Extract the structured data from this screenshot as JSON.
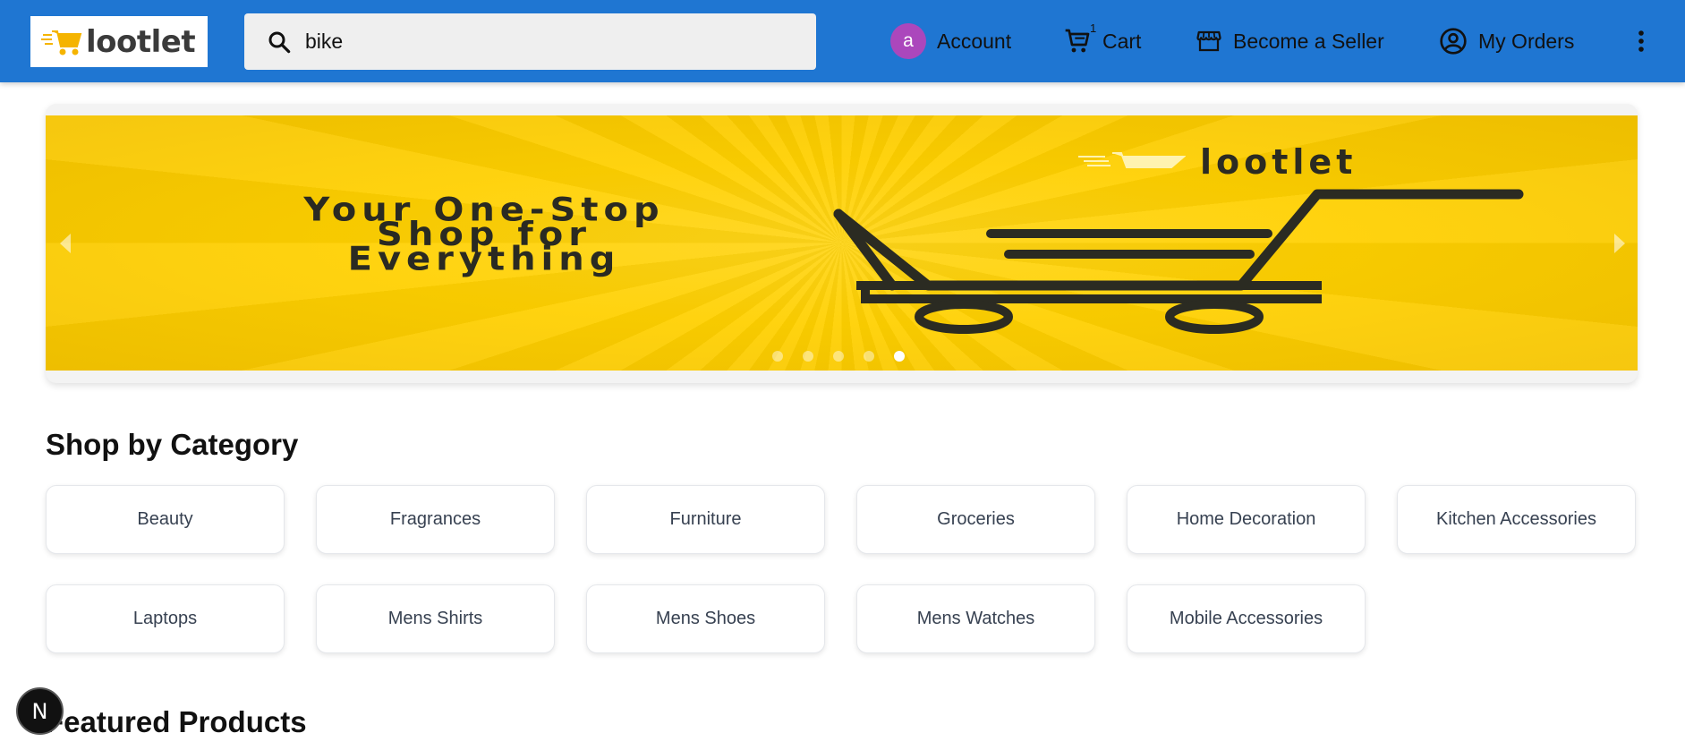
{
  "header": {
    "logo_text": "lootlet",
    "search": {
      "value": "bike"
    },
    "account": {
      "avatar_letter": "a",
      "label": "Account"
    },
    "cart": {
      "label": "Cart",
      "count": "1"
    },
    "seller": {
      "label": "Become a Seller"
    },
    "orders": {
      "label": "My Orders"
    }
  },
  "banner": {
    "slogan": "Your One-Stop Shop for Everything",
    "brand": "lootlet",
    "slides": 5,
    "active_slide": 5,
    "colors": {
      "background": "#ffd000",
      "ink": "#2b2b22"
    }
  },
  "categories": {
    "title": "Shop by Category",
    "items": [
      "Beauty",
      "Fragrances",
      "Furniture",
      "Groceries",
      "Home Decoration",
      "Kitchen Accessories",
      "Laptops",
      "Mens Shirts",
      "Mens Shoes",
      "Mens Watches",
      "Mobile Accessories"
    ]
  },
  "featured": {
    "title": "Featured Products"
  },
  "dev_badge": {
    "letter": "N"
  },
  "colors": {
    "header": "#1f76d2",
    "avatar": "#ab47bc"
  }
}
